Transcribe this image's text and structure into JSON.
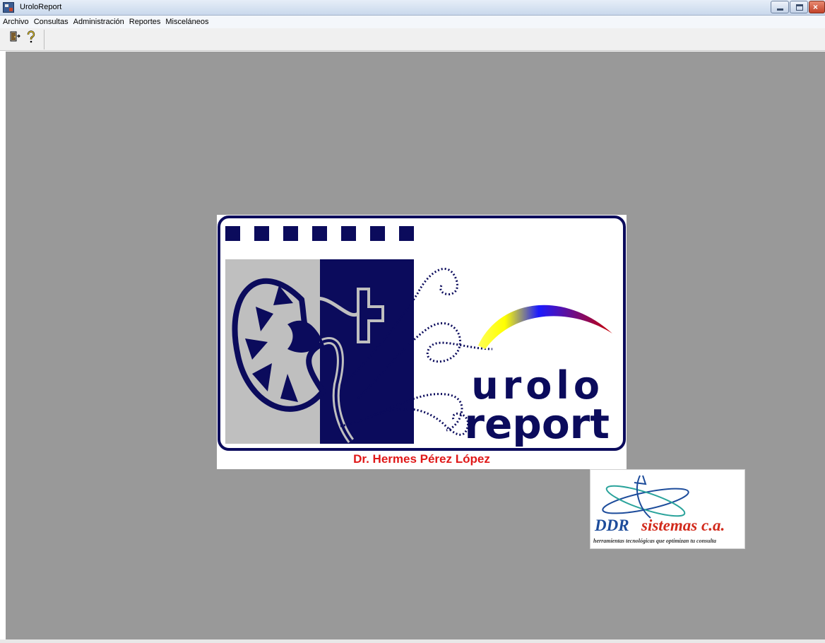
{
  "window": {
    "title": "UroloReport",
    "controls": {
      "minimize_icon": "minimize-icon",
      "maximize_icon": "restore-icon",
      "close_icon": "close-icon"
    }
  },
  "menu": {
    "items": [
      {
        "label": "Archivo"
      },
      {
        "label": "Consultas"
      },
      {
        "label": "Administración"
      },
      {
        "label": "Reportes"
      },
      {
        "label": "Misceláneos"
      }
    ]
  },
  "toolbar": {
    "buttons": [
      {
        "icon": "exit-door-icon"
      },
      {
        "icon": "help-question-icon"
      }
    ]
  },
  "logo": {
    "word_top": "urolo",
    "word_bottom": "report",
    "author": "Dr. Hermes Pérez López",
    "colors": {
      "navy": "#0b0b5c",
      "gray": "#bfbfbf",
      "gradient": [
        "#ffff33",
        "#1a1aff",
        "#cc0000"
      ]
    }
  },
  "partner_logo": {
    "brand_ddr": "DDR",
    "brand_rest": "sistemas c.a.",
    "tagline": "herramientas tecnológicas que optimizan tu consulta",
    "colors": {
      "ddr": "#1d4c9b",
      "rest": "#d22a1c"
    }
  },
  "workspace": {
    "background": "#999999"
  }
}
